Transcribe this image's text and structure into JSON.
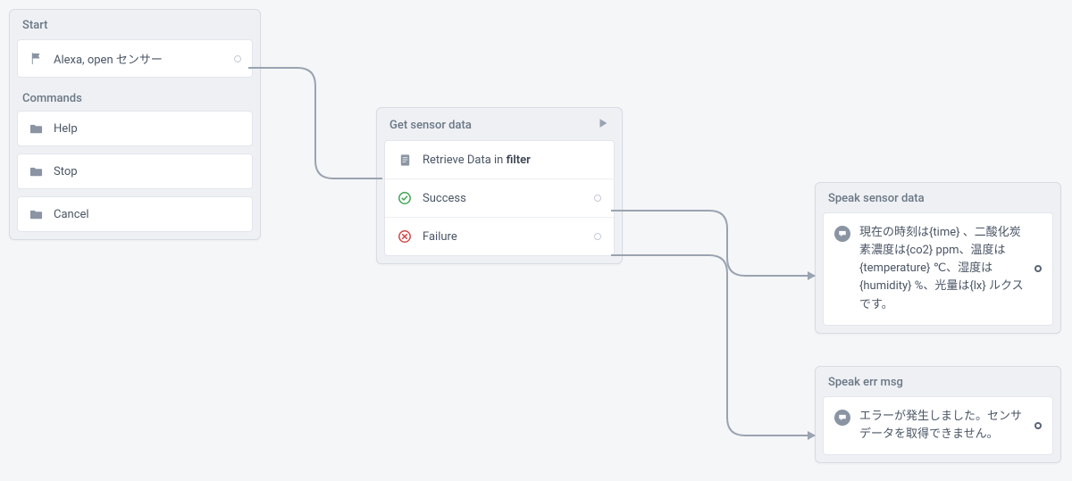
{
  "start_panel": {
    "title": "Start",
    "launch_label": "Alexa, open センサー",
    "commands_title": "Commands",
    "commands": [
      "Help",
      "Stop",
      "Cancel"
    ]
  },
  "sensor_panel": {
    "title": "Get sensor data",
    "retrieve_prefix": "Retrieve Data in ",
    "retrieve_arg": "filter",
    "success_label": "Success",
    "failure_label": "Failure"
  },
  "speak_panel": {
    "title": "Speak sensor data",
    "text": "現在の時刻は{time} 、二酸化炭素濃度は{co2} ppm、温度は{temperature} ℃、湿度は{humidity} %、光量は{lx} ルクスです。"
  },
  "err_panel": {
    "title": "Speak err msg",
    "text": "エラーが発生しました。センサデータを取得できません。"
  }
}
